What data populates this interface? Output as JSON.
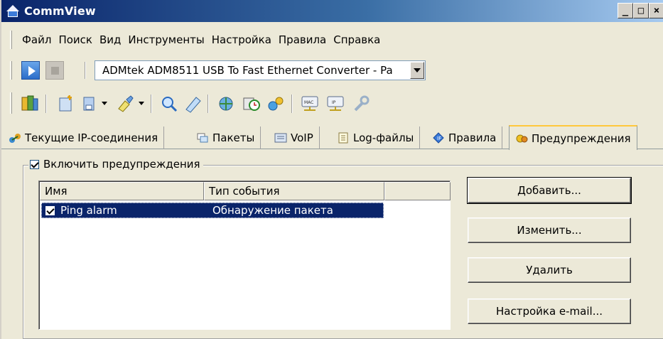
{
  "window": {
    "title": "CommView"
  },
  "menu": [
    "Файл",
    "Поиск",
    "Вид",
    "Инструменты",
    "Настройка",
    "Правила",
    "Справка"
  ],
  "adapter": {
    "selected": "ADMtek ADM8511 USB To Fast Ethernet Converter - Pa"
  },
  "toolbar_icons": [
    "open-icon",
    "new-icon",
    "save-icon",
    "paint-icon",
    "search-icon",
    "edit-icon",
    "network-icon",
    "scheduler-icon",
    "alias-icon",
    "mac-icon",
    "ip-icon",
    "wrench-icon"
  ],
  "tabs": [
    {
      "label": "Текущие IP-соединения",
      "icon": "connections-icon"
    },
    {
      "label": "Пакеты",
      "icon": "packets-icon"
    },
    {
      "label": "VoIP",
      "icon": "voip-icon"
    },
    {
      "label": "Log-файлы",
      "icon": "logs-icon"
    },
    {
      "label": "Правила",
      "icon": "rules-icon"
    },
    {
      "label": "Предупреждения",
      "icon": "alerts-icon",
      "active": true
    }
  ],
  "alerts": {
    "enable_label": "Включить предупреждения",
    "enabled": true,
    "columns": [
      "Имя",
      "Тип события"
    ],
    "rows": [
      {
        "name": "Ping alarm",
        "type": "Обнаружение пакета",
        "checked": true,
        "selected": true
      }
    ],
    "buttons": {
      "add": "Добавить...",
      "edit": "Изменить...",
      "delete": "Удалить",
      "email": "Настройка e-mail..."
    }
  },
  "colors": {
    "selection": "#0a246a",
    "titlebar": "#0a246a",
    "active_tab_accent": "#ffc83c"
  }
}
